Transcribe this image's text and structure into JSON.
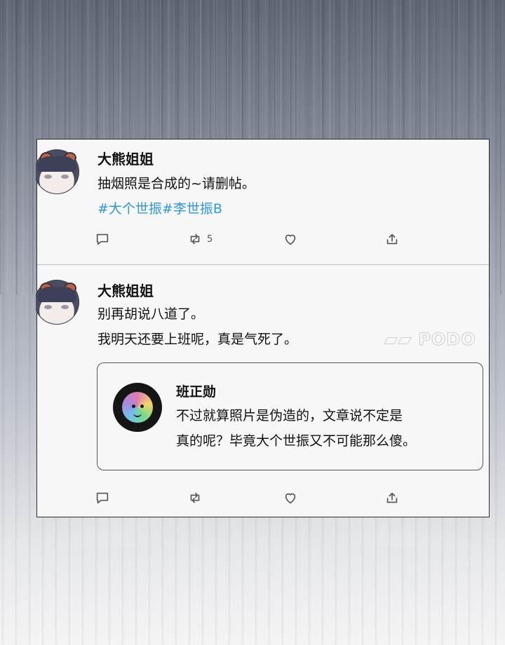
{
  "tweets": [
    {
      "author": "大熊姐姐",
      "lines": [
        "抽烟照是合成的~请删帖。"
      ],
      "hashtags": "#大个世振#李世振B",
      "retweet_count": "5",
      "icons": [
        "reply-icon",
        "retweet-icon",
        "like-icon",
        "share-icon"
      ]
    },
    {
      "author": "大熊姐姐",
      "lines": [
        "别再胡说八道了。",
        "我明天还要上班呢，真是气死了。"
      ],
      "quote": {
        "author": "班正勋",
        "lines": [
          "不过就算照片是伪造的，文章说不定是",
          "真的呢？毕竟大个世振又不可能那么傻。"
        ]
      }
    }
  ],
  "watermark": "PODO",
  "colors": {
    "hashtag": "#2f97d6",
    "card_bg": "#f7f7f8",
    "border": "#2b2b2b"
  }
}
